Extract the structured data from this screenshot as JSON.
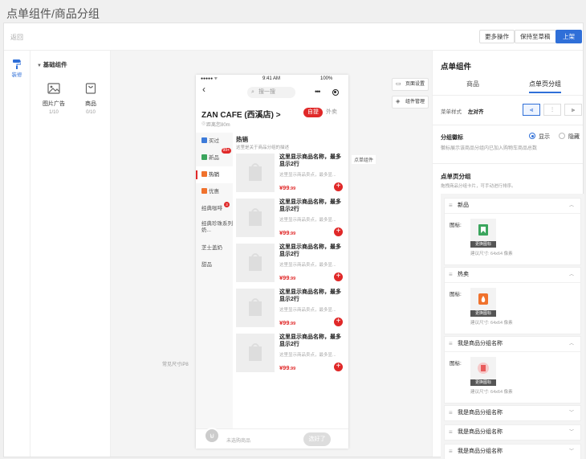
{
  "page": {
    "title": "点单组件/商品分组"
  },
  "topbar": {
    "back": "返回",
    "more": "更多操作",
    "save_draft": "保持至草稿",
    "publish": "上架"
  },
  "rail": {
    "label": "装修"
  },
  "library": {
    "title": "基础组件",
    "components": [
      {
        "name": "图片广告",
        "count": "1/10"
      },
      {
        "name": "商品",
        "count": "0/10"
      }
    ]
  },
  "canvas": {
    "component_label": "点单组件",
    "size_label": "常见尺寸iP8",
    "side_buttons": [
      "页面设置",
      "组件管理"
    ]
  },
  "phone": {
    "time": "9:41 AM",
    "battery": "100%",
    "signal": "●●●●● ᯤ",
    "search_placeholder": "搜一搜",
    "store_name": "ZAN CAFE (西溪店) >",
    "distance": "距离您80m",
    "mode_pickup": "自提",
    "mode_delivery": "外卖",
    "categories": [
      {
        "label": "买过",
        "color": "#3d7bd9"
      },
      {
        "label": "新品",
        "color": "#3ba55d",
        "badge": "99+"
      },
      {
        "label": "热销",
        "color": "#f0722d"
      },
      {
        "label": "优惠",
        "color": "#f0722d"
      },
      {
        "label": "经典咖啡",
        "dot": "3"
      },
      {
        "label": "经典珍珠系列奶..."
      },
      {
        "label": "芝士盖奶"
      },
      {
        "label": "甜品"
      }
    ],
    "section_title": "热销",
    "section_desc": "这里是关于商品分组的描述",
    "products": [
      {
        "name": "这里显示商品名称，最多显示2行",
        "desc": "这里显示商品卖点，最多显...",
        "price_int": "¥99",
        "price_dec": ".99"
      },
      {
        "name": "这里显示商品名称，最多显示2行",
        "desc": "这里显示商品卖点，最多显...",
        "price_int": "¥99",
        "price_dec": ".99"
      },
      {
        "name": "这里显示商品名称，最多显示2行",
        "desc": "这里显示商品卖点，最多显...",
        "price_int": "¥99",
        "price_dec": ".99"
      },
      {
        "name": "这里显示商品名称，最多显示2行",
        "desc": "这里显示商品卖点，最多显...",
        "price_int": "¥99",
        "price_dec": ".99"
      },
      {
        "name": "这里显示商品名称，最多显示2行",
        "desc": "这里显示商品卖点，最多显...",
        "price_int": "¥99",
        "price_dec": ".99"
      }
    ],
    "cart_empty": "未选购商品",
    "cart_go": "选好了"
  },
  "panel": {
    "title": "点单组件",
    "tabs": [
      "商品",
      "点单页分组"
    ],
    "menu_style_label": "菜单样式",
    "menu_style_value": "左对齐",
    "align_icons": [
      "align-left-icon",
      "align-center-icon",
      "align-right-icon"
    ],
    "icon_label": "分组徽标",
    "icon_desc": "徽标展示该商品分组内已加入购物车商品总数",
    "icon_show": "显示",
    "icon_hide": "隐藏",
    "group_title": "点单页分组",
    "group_desc": "拖拽商品分组卡片，可手动进行排序。",
    "groups": [
      {
        "name": "新品",
        "expanded": true,
        "icon_label": "图标:",
        "change": "更换图标",
        "size": "建议尺寸: 64x64 像素",
        "color": "#3ba55d"
      },
      {
        "name": "热卖",
        "expanded": true,
        "icon_label": "图标:",
        "change": "更换图标",
        "size": "建议尺寸: 64x64 像素",
        "color": "#f0722d"
      },
      {
        "name": "我是商品分组名称",
        "expanded": true,
        "icon_label": "图标:",
        "change": "更换图标",
        "size": "建议尺寸: 64x64 像素",
        "color": "#e85b5b"
      },
      {
        "name": "我是商品分组名称",
        "expanded": false
      },
      {
        "name": "我是商品分组名称",
        "expanded": false
      },
      {
        "name": "我是商品分组名称",
        "expanded": false
      }
    ]
  },
  "colors": {
    "accent": "#2f6fd8",
    "brand_red": "#e02828"
  }
}
